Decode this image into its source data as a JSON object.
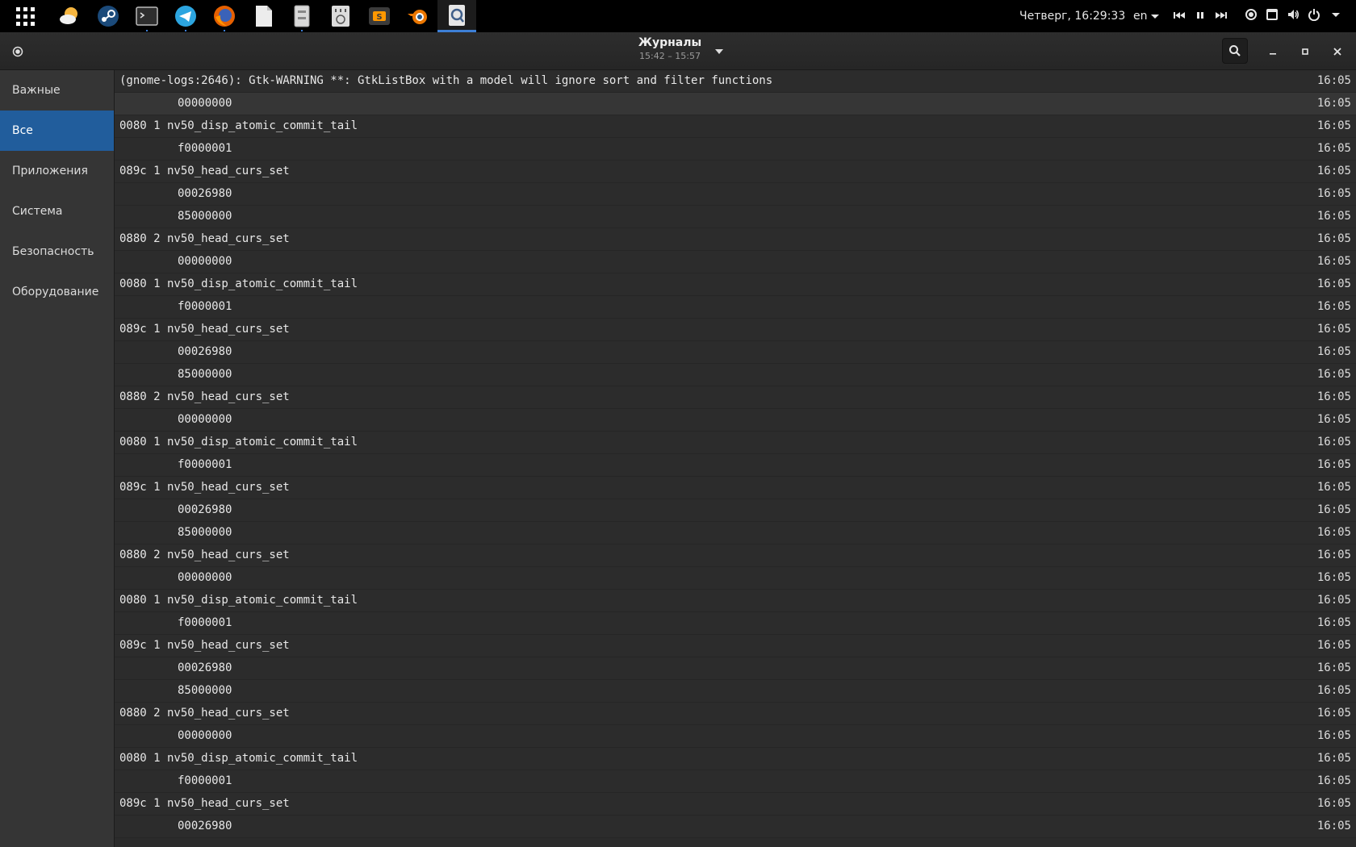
{
  "top_panel": {
    "clock": "Четверг, 16:29:33",
    "language": "en",
    "dock_apps": [
      {
        "name": "weather-app-icon",
        "color": "#f5b53f",
        "running": false
      },
      {
        "name": "steam-icon",
        "color": "#1b4a7a",
        "running": false
      },
      {
        "name": "terminal-icon",
        "color": "#3a3a3a",
        "running": true
      },
      {
        "name": "telegram-icon",
        "color": "#2ca5e0",
        "running": true
      },
      {
        "name": "firefox-icon",
        "color": "#e66000",
        "running": true
      },
      {
        "name": "text-editor-icon",
        "color": "#e8e8e8",
        "running": false
      },
      {
        "name": "file-manager-icon",
        "color": "#d9d9d9",
        "running": true
      },
      {
        "name": "audio-mixer-icon",
        "color": "#dddddd",
        "running": false
      },
      {
        "name": "sublime-text-icon",
        "color": "#ff9800",
        "running": false
      },
      {
        "name": "blender-icon",
        "color": "#ea7600",
        "running": false
      },
      {
        "name": "logs-app-icon",
        "color": "#e0e0e0",
        "running": true,
        "active": true
      }
    ]
  },
  "header": {
    "title": "Журналы",
    "subtitle": "15:42 – 15:57"
  },
  "sidebar": {
    "items": [
      {
        "label": "Важные",
        "selected": false
      },
      {
        "label": "Все",
        "selected": true
      },
      {
        "label": "Приложения",
        "selected": false
      },
      {
        "label": "Система",
        "selected": false
      },
      {
        "label": "Безопасность",
        "selected": false
      },
      {
        "label": "Оборудование",
        "selected": false
      }
    ]
  },
  "log": {
    "rows": [
      {
        "message": "(gnome-logs:2646): Gtk-WARNING **: GtkListBox with a model will ignore sort and filter functions",
        "time": "16:05",
        "indent": false,
        "hover": false
      },
      {
        "message": "00000000",
        "time": "16:05",
        "indent": true,
        "hover": true
      },
      {
        "message": "0080 1 nv50_disp_atomic_commit_tail",
        "time": "16:05",
        "indent": false,
        "hover": false
      },
      {
        "message": "f0000001",
        "time": "16:05",
        "indent": true,
        "hover": false
      },
      {
        "message": "089c 1 nv50_head_curs_set",
        "time": "16:05",
        "indent": false,
        "hover": false
      },
      {
        "message": "00026980",
        "time": "16:05",
        "indent": true,
        "hover": false
      },
      {
        "message": "85000000",
        "time": "16:05",
        "indent": true,
        "hover": false
      },
      {
        "message": "0880 2 nv50_head_curs_set",
        "time": "16:05",
        "indent": false,
        "hover": false
      },
      {
        "message": "00000000",
        "time": "16:05",
        "indent": true,
        "hover": false
      },
      {
        "message": "0080 1 nv50_disp_atomic_commit_tail",
        "time": "16:05",
        "indent": false,
        "hover": false
      },
      {
        "message": "f0000001",
        "time": "16:05",
        "indent": true,
        "hover": false
      },
      {
        "message": "089c 1 nv50_head_curs_set",
        "time": "16:05",
        "indent": false,
        "hover": false
      },
      {
        "message": "00026980",
        "time": "16:05",
        "indent": true,
        "hover": false
      },
      {
        "message": "85000000",
        "time": "16:05",
        "indent": true,
        "hover": false
      },
      {
        "message": "0880 2 nv50_head_curs_set",
        "time": "16:05",
        "indent": false,
        "hover": false
      },
      {
        "message": "00000000",
        "time": "16:05",
        "indent": true,
        "hover": false
      },
      {
        "message": "0080 1 nv50_disp_atomic_commit_tail",
        "time": "16:05",
        "indent": false,
        "hover": false
      },
      {
        "message": "f0000001",
        "time": "16:05",
        "indent": true,
        "hover": false
      },
      {
        "message": "089c 1 nv50_head_curs_set",
        "time": "16:05",
        "indent": false,
        "hover": false
      },
      {
        "message": "00026980",
        "time": "16:05",
        "indent": true,
        "hover": false
      },
      {
        "message": "85000000",
        "time": "16:05",
        "indent": true,
        "hover": false
      },
      {
        "message": "0880 2 nv50_head_curs_set",
        "time": "16:05",
        "indent": false,
        "hover": false
      },
      {
        "message": "00000000",
        "time": "16:05",
        "indent": true,
        "hover": false
      },
      {
        "message": "0080 1 nv50_disp_atomic_commit_tail",
        "time": "16:05",
        "indent": false,
        "hover": false
      },
      {
        "message": "f0000001",
        "time": "16:05",
        "indent": true,
        "hover": false
      },
      {
        "message": "089c 1 nv50_head_curs_set",
        "time": "16:05",
        "indent": false,
        "hover": false
      },
      {
        "message": "00026980",
        "time": "16:05",
        "indent": true,
        "hover": false
      },
      {
        "message": "85000000",
        "time": "16:05",
        "indent": true,
        "hover": false
      },
      {
        "message": "0880 2 nv50_head_curs_set",
        "time": "16:05",
        "indent": false,
        "hover": false
      },
      {
        "message": "00000000",
        "time": "16:05",
        "indent": true,
        "hover": false
      },
      {
        "message": "0080 1 nv50_disp_atomic_commit_tail",
        "time": "16:05",
        "indent": false,
        "hover": false
      },
      {
        "message": "f0000001",
        "time": "16:05",
        "indent": true,
        "hover": false
      },
      {
        "message": "089c 1 nv50_head_curs_set",
        "time": "16:05",
        "indent": false,
        "hover": false
      },
      {
        "message": "00026980",
        "time": "16:05",
        "indent": true,
        "hover": false
      }
    ]
  },
  "colors": {
    "selection": "#215d9c",
    "active_indicator": "#3d7fd6",
    "list_background": "#2c2c2c",
    "sidebar_background": "#353535"
  }
}
